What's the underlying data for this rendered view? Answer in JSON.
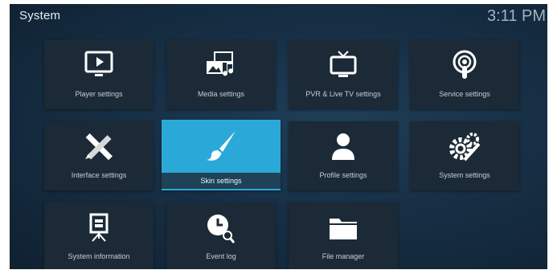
{
  "header": {
    "title": "System",
    "clock": "3:11 PM"
  },
  "tiles": [
    {
      "label": "Player settings",
      "icon": "tv-play-icon"
    },
    {
      "label": "Media settings",
      "icon": "media-icon"
    },
    {
      "label": "PVR & Live TV settings",
      "icon": "live-tv-icon"
    },
    {
      "label": "Service settings",
      "icon": "podcast-icon"
    },
    {
      "label": "Interface settings",
      "icon": "pencil-ruler-icon"
    },
    {
      "label": "Skin settings",
      "icon": "brush-icon"
    },
    {
      "label": "Profile settings",
      "icon": "user-icon"
    },
    {
      "label": "System settings",
      "icon": "gears-wrench-icon"
    },
    {
      "label": "System information",
      "icon": "presentation-icon"
    },
    {
      "label": "Event log",
      "icon": "clock-search-icon"
    },
    {
      "label": "File manager",
      "icon": "folder-icon"
    }
  ],
  "selected_tile": "Skin settings",
  "colors": {
    "background": "#172f45",
    "tile": "#1b2a36",
    "highlight": "#2aa9d9"
  }
}
